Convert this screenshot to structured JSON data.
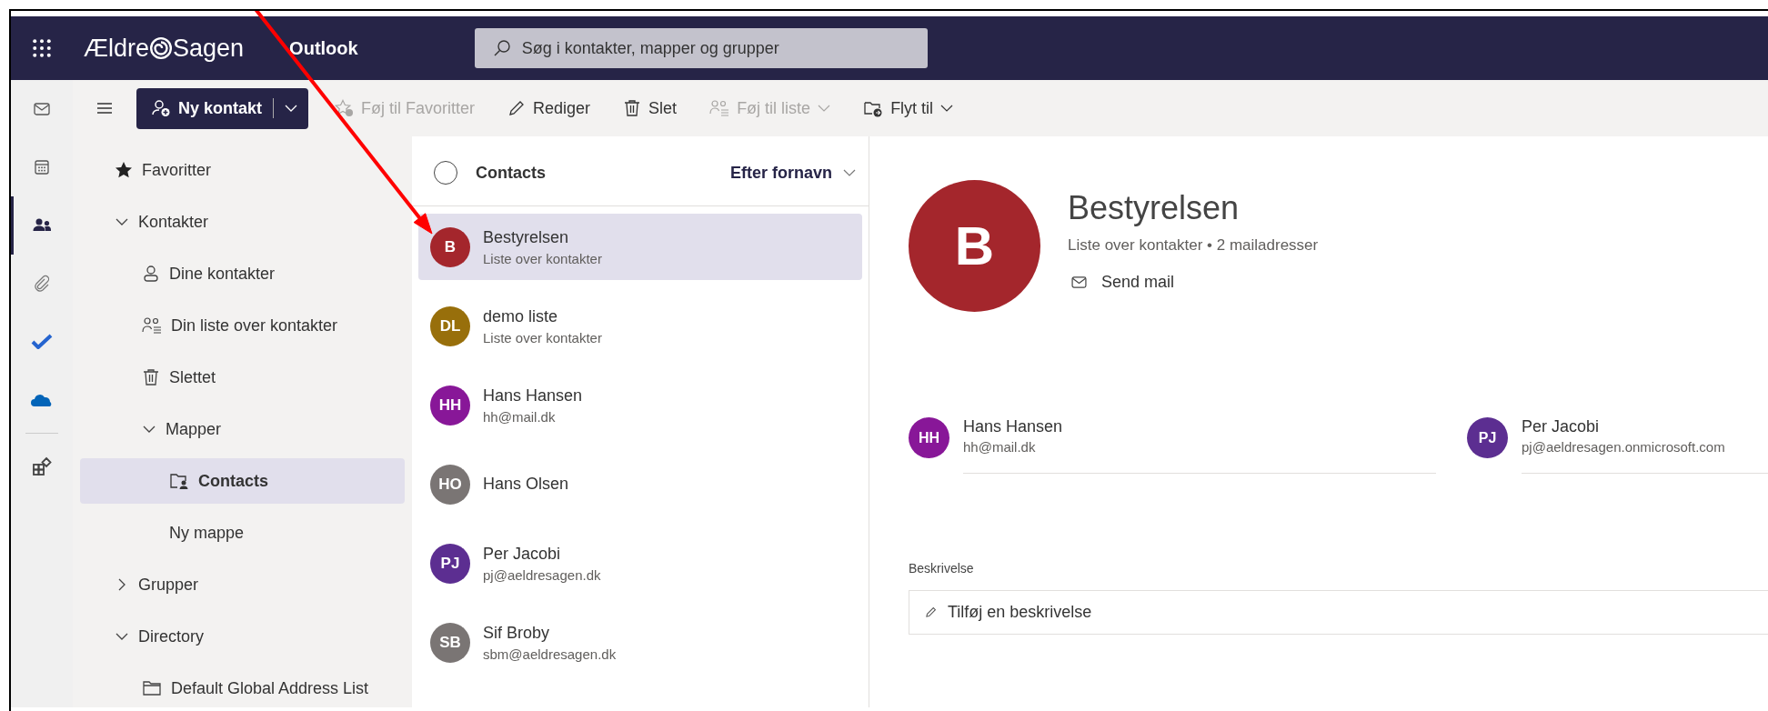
{
  "app_bar": {
    "brand_parts": [
      "Ældre",
      "Sagen"
    ],
    "app_name": "Outlook",
    "search": {
      "placeholder": "Søg i kontakter, mapper og grupper"
    }
  },
  "rail": [
    {
      "kind": "mail",
      "selected": false
    },
    {
      "kind": "calendar",
      "selected": false
    },
    {
      "kind": "people",
      "selected": true
    },
    {
      "kind": "attach",
      "selected": false
    },
    {
      "kind": "todo",
      "selected": false
    },
    {
      "kind": "cloud",
      "selected": false
    },
    {
      "kind": "apps",
      "selected": false
    }
  ],
  "toolbar": {
    "new_button": {
      "label": "Ny kontakt"
    },
    "actions": [
      {
        "kind": "favorite",
        "label": "Føj til Favoritter",
        "disabled": true,
        "dropdown": false
      },
      {
        "kind": "edit",
        "label": "Rediger",
        "disabled": false,
        "dropdown": false
      },
      {
        "kind": "delete",
        "label": "Slet",
        "disabled": false,
        "dropdown": false
      },
      {
        "kind": "list",
        "label": "Føj til liste",
        "disabled": true,
        "dropdown": true
      },
      {
        "kind": "move",
        "label": "Flyt til",
        "disabled": false,
        "dropdown": true
      }
    ]
  },
  "folders": [
    {
      "label": "Favoritter",
      "kind": "star",
      "selected": false
    },
    {
      "label": "Kontakter",
      "expanded": true,
      "selected": false,
      "children": [
        {
          "label": "Dine kontakter",
          "kind": "person",
          "selected": false
        },
        {
          "label": "Din liste over kontakter",
          "kind": "people-list",
          "selected": false
        },
        {
          "label": "Slettet",
          "kind": "trash",
          "selected": false
        },
        {
          "label": "Mapper",
          "expanded": true,
          "selected": false,
          "children": [
            {
              "label": "Contacts",
              "kind": "contact-folder",
              "selected": true
            },
            {
              "label": "Ny mappe",
              "selected": false
            }
          ]
        }
      ]
    },
    {
      "label": "Grupper",
      "expanded": false,
      "selected": false
    },
    {
      "label": "Directory",
      "expanded": true,
      "selected": false,
      "children": [
        {
          "label": "Default Global Address List",
          "kind": "folder",
          "selected": false
        }
      ]
    }
  ],
  "contact_list": {
    "title": "Contacts",
    "checked": false,
    "sort": "Efter fornavn",
    "contacts": [
      {
        "initials": "B",
        "name": "Bestyrelsen",
        "detail": "Liste over kontakter",
        "color": "#a4262c",
        "selected": true
      },
      {
        "initials": "DL",
        "name": "demo liste",
        "detail": "Liste over kontakter",
        "color": "#986f0b",
        "selected": false
      },
      {
        "initials": "HH",
        "name": "Hans Hansen",
        "detail": "hh@mail.dk",
        "color": "#881798",
        "selected": false
      },
      {
        "initials": "HO",
        "name": "Hans Olsen",
        "color": "#7a7574",
        "selected": false
      },
      {
        "initials": "PJ",
        "name": "Per Jacobi",
        "detail": "pj@aeldresagen.dk",
        "color": "#5c2e91",
        "selected": false
      },
      {
        "initials": "SB",
        "name": "Sif Broby",
        "detail": "sbm@aeldresagen.dk",
        "color": "#7a7574",
        "selected": false
      }
    ]
  },
  "detail": {
    "initials": "B",
    "color": "#a4262c",
    "name": "Bestyrelsen",
    "subtitle": "Liste over kontakter • 2 mailadresser",
    "send_mail": "Send mail",
    "members": [
      {
        "initials": "HH",
        "name": "Hans Hansen",
        "email": "hh@mail.dk",
        "color": "#881798"
      },
      {
        "initials": "PJ",
        "name": "Per Jacobi",
        "email": "pj@aeldresagen.onmicrosoft.com",
        "color": "#5c2e91"
      }
    ],
    "description": {
      "label": "Beskrivelse",
      "placeholder": "Tilføj en beskrivelse"
    }
  }
}
